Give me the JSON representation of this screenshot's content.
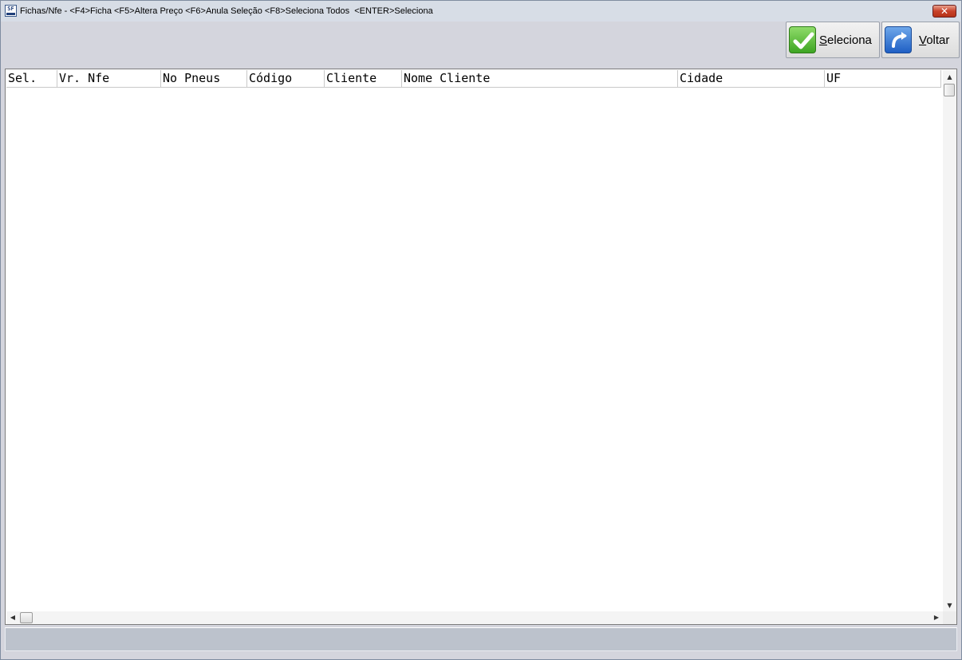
{
  "window": {
    "title": "Fichas/Nfe - <F4>Ficha <F5>Altera Preço <F6>Anula Seleção <F8>Seleciona Todos  <ENTER>Seleciona",
    "app_icon_text": "SF",
    "close_glyph": "✕"
  },
  "toolbar": {
    "select_button": {
      "label_first": "S",
      "label_rest": "eleciona",
      "icon": "checkmark-icon"
    },
    "back_button": {
      "label_first": "V",
      "label_rest": "oltar",
      "icon": "return-arrow-icon"
    }
  },
  "grid": {
    "columns": [
      "Sel.",
      "Vr. Nfe",
      "No Pneus",
      "Código",
      "Cliente",
      "Nome Cliente",
      "Cidade",
      "UF"
    ],
    "rows": []
  },
  "scrollbars": {
    "up": "▲",
    "down": "▼",
    "left": "◀",
    "right": "▶"
  },
  "colors": {
    "window_bg": "#d4d5dd",
    "select_icon": "#3ea523",
    "back_icon": "#1f5fc4",
    "close_button": "#c8412a"
  }
}
